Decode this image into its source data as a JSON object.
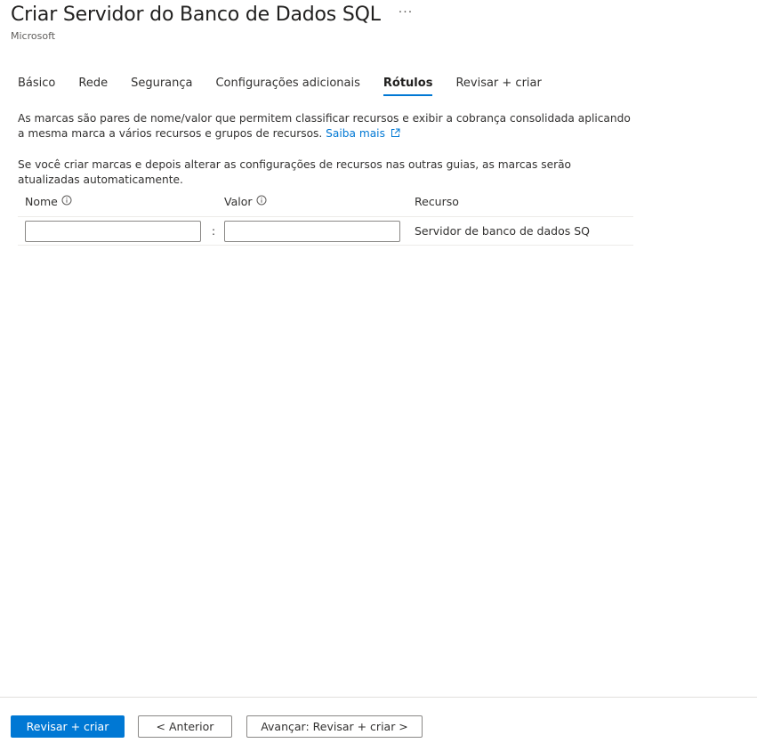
{
  "header": {
    "title": "Criar Servidor do Banco de Dados SQL",
    "more": "···",
    "publisher": "Microsoft"
  },
  "tabs": [
    {
      "label": "Básico",
      "active": false
    },
    {
      "label": "Rede",
      "active": false
    },
    {
      "label": "Segurança",
      "active": false
    },
    {
      "label": "Configurações adicionais",
      "active": false
    },
    {
      "label": "Rótulos",
      "active": true
    },
    {
      "label": "Revisar + criar",
      "active": false
    }
  ],
  "description": {
    "paragraph1": "As marcas são pares de nome/valor que permitem classificar recursos e exibir a cobrança consolidada aplicando a mesma marca a vários recursos e grupos de recursos.",
    "learn_more": "Saiba mais",
    "paragraph2": "Se você criar marcas e depois alterar as configurações de recursos nas outras guias, as marcas serão atualizadas automaticamente."
  },
  "table": {
    "headers": {
      "name": "Nome",
      "value": "Valor",
      "resource": "Recurso"
    },
    "rows": [
      {
        "name": "",
        "value": "",
        "separator": ":",
        "resource": "Servidor de banco de dados SQ"
      }
    ]
  },
  "footer": {
    "primary": "Revisar + criar",
    "previous": "< Anterior",
    "next": "Avançar: Revisar + criar >"
  },
  "colors": {
    "accent": "#0078d4",
    "text": "#323130",
    "border": "#8a8886"
  }
}
